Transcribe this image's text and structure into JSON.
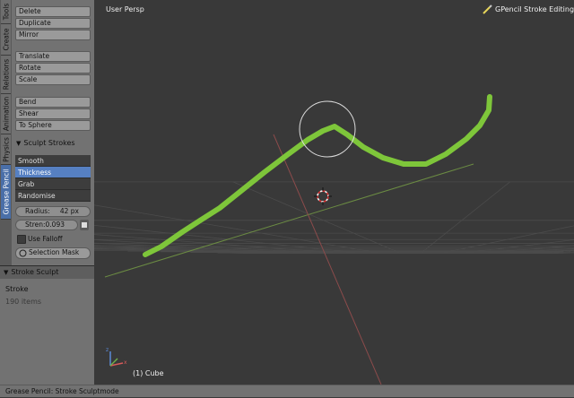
{
  "tabs": [
    "Tools",
    "Create",
    "Relations",
    "Animation",
    "Physics",
    "Grease Pencil"
  ],
  "active_tab": "Grease Pencil",
  "edit_buttons": [
    "Delete",
    "Duplicate",
    "Mirror"
  ],
  "transform_buttons": [
    "Translate",
    "Rotate",
    "Scale"
  ],
  "deform_buttons": [
    "Bend",
    "Shear",
    "To Sphere"
  ],
  "sculpt": {
    "header": "Sculpt Strokes",
    "brushes": [
      "Smooth",
      "Thickness",
      "Grab",
      "Randomise"
    ],
    "active_brush": "Thickness",
    "radius_label": "Radius:",
    "radius_value": "42 px",
    "strength_label": "Stren:",
    "strength_value": "0.093",
    "use_falloff_label": "Use Falloff",
    "use_falloff_checked": false,
    "selection_mask_label": "Selection Mask"
  },
  "operator_panel": {
    "header": "Stroke Sculpt",
    "name": "Stroke",
    "items": "190 items"
  },
  "viewport": {
    "view_label": "User Persp",
    "mode_label": "GPencil Stroke Editing",
    "object_label": "(1) Cube",
    "stroke_color": "#7ec63a",
    "x_axis_color": "#8b4b4b",
    "y_axis_color": "#6b8b43"
  },
  "status_bar": "Grease Pencil: Stroke Sculptmode"
}
